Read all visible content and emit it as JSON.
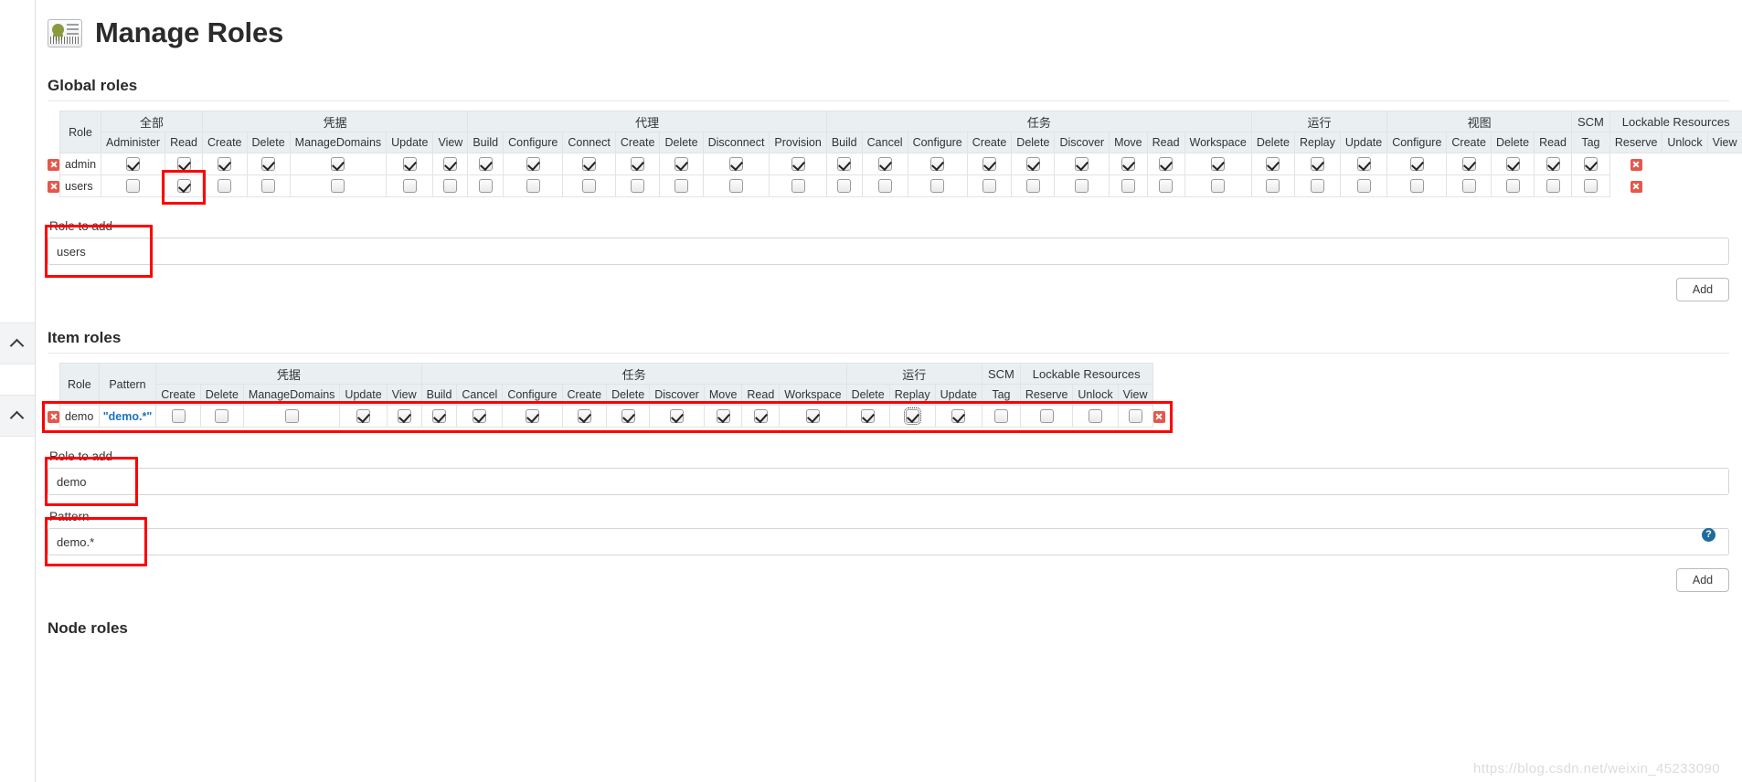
{
  "page": {
    "title": "Manage Roles",
    "icon": "id-badge-icon",
    "watermark": "https://blog.csdn.net/weixin_45233090"
  },
  "sidebar": {
    "items": [
      {
        "name": "collapse-chevron-1",
        "icon": "chevron-up-icon"
      },
      {
        "name": "collapse-chevron-2",
        "icon": "chevron-up-icon"
      }
    ]
  },
  "global_roles": {
    "heading": "Global roles",
    "role_header": "Role",
    "groups": [
      {
        "label": "全部",
        "cols": [
          "Administer",
          "Read"
        ]
      },
      {
        "label": "凭据",
        "cols": [
          "Create",
          "Delete",
          "ManageDomains",
          "Update",
          "View"
        ]
      },
      {
        "label": "代理",
        "cols": [
          "Build",
          "Configure",
          "Connect",
          "Create",
          "Delete",
          "Disconnect",
          "Provision"
        ]
      },
      {
        "label": "任务",
        "cols": [
          "Build",
          "Cancel",
          "Configure",
          "Create",
          "Delete",
          "Discover",
          "Move",
          "Read",
          "Workspace"
        ]
      },
      {
        "label": "运行",
        "cols": [
          "Delete",
          "Replay",
          "Update"
        ]
      },
      {
        "label": "视图",
        "cols": [
          "Configure",
          "Create",
          "Delete",
          "Read"
        ]
      },
      {
        "label": "SCM",
        "cols": [
          "Tag"
        ]
      },
      {
        "label": "Lockable Resources",
        "cols": [
          "Reserve",
          "Unlock",
          "View"
        ]
      }
    ],
    "rows": [
      {
        "role": "admin",
        "delete_icon": "delete-role-icon",
        "checks": [
          true,
          true,
          true,
          true,
          true,
          true,
          true,
          true,
          true,
          true,
          true,
          true,
          true,
          true,
          true,
          true,
          true,
          true,
          true,
          true,
          true,
          true,
          true,
          true,
          true,
          true,
          true,
          true,
          true,
          true,
          true
        ]
      },
      {
        "role": "users",
        "delete_icon": "delete-role-icon",
        "checks": [
          false,
          true,
          false,
          false,
          false,
          false,
          false,
          false,
          false,
          false,
          false,
          false,
          false,
          false,
          false,
          false,
          false,
          false,
          false,
          false,
          false,
          false,
          false,
          false,
          false,
          false,
          false,
          false,
          false,
          false,
          false
        ]
      }
    ],
    "role_to_add": {
      "label": "Role to add",
      "value": "users",
      "placeholder": ""
    },
    "add_button": "Add"
  },
  "item_roles": {
    "heading": "Item roles",
    "role_header": "Role",
    "pattern_header": "Pattern",
    "groups": [
      {
        "label": "凭据",
        "cols": [
          "Create",
          "Delete",
          "ManageDomains",
          "Update",
          "View"
        ]
      },
      {
        "label": "任务",
        "cols": [
          "Build",
          "Cancel",
          "Configure",
          "Create",
          "Delete",
          "Discover",
          "Move",
          "Read",
          "Workspace"
        ]
      },
      {
        "label": "运行",
        "cols": [
          "Delete",
          "Replay",
          "Update"
        ]
      },
      {
        "label": "SCM",
        "cols": [
          "Tag"
        ]
      },
      {
        "label": "Lockable Resources",
        "cols": [
          "Reserve",
          "Unlock",
          "View"
        ]
      }
    ],
    "rows": [
      {
        "role": "demo",
        "pattern": "\"demo.*\"",
        "delete_icon": "delete-role-icon",
        "checks": [
          false,
          false,
          false,
          true,
          true,
          true,
          true,
          true,
          true,
          true,
          true,
          true,
          true,
          true,
          true,
          true,
          true,
          false,
          false,
          false,
          false
        ],
        "focused_index": 15
      }
    ],
    "role_to_add": {
      "label": "Role to add",
      "value": "demo",
      "placeholder": ""
    },
    "pattern": {
      "label": "Pattern",
      "value": "demo.*",
      "placeholder": "",
      "help_icon": "help-icon"
    },
    "add_button": "Add"
  },
  "node_roles": {
    "heading": "Node roles"
  }
}
